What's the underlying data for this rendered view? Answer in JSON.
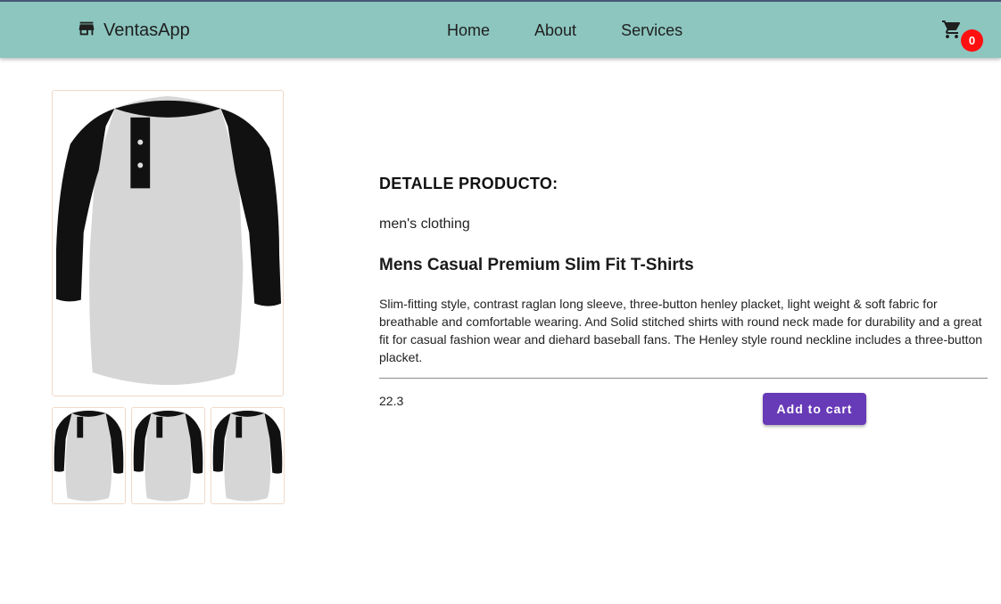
{
  "navbar": {
    "brand": "VentasApp",
    "brand_icon": "store-icon",
    "links": [
      {
        "label": "Home"
      },
      {
        "label": "About"
      },
      {
        "label": "Services"
      }
    ],
    "cart_icon": "shopping-cart-icon",
    "cart_count": "0",
    "background_color": "#8cc6bf"
  },
  "product": {
    "section_heading": "DETALLE PRODUCTO:",
    "category": "men's clothing",
    "title": "Mens Casual Premium Slim Fit T-Shirts",
    "description": "Slim-fitting style, contrast raglan long sleeve, three-button henley placket, light weight & soft fabric for breathable and comfortable wearing. And Solid stitched shirts with round neck made for durability and a great fit for casual fashion wear and diehard baseball fans. The Henley style round neckline includes a three-button placket.",
    "price": "22.3",
    "add_to_cart_label": "Add to cart",
    "button_color": "#673ab7",
    "image_icon": "henley-shirt-image"
  }
}
